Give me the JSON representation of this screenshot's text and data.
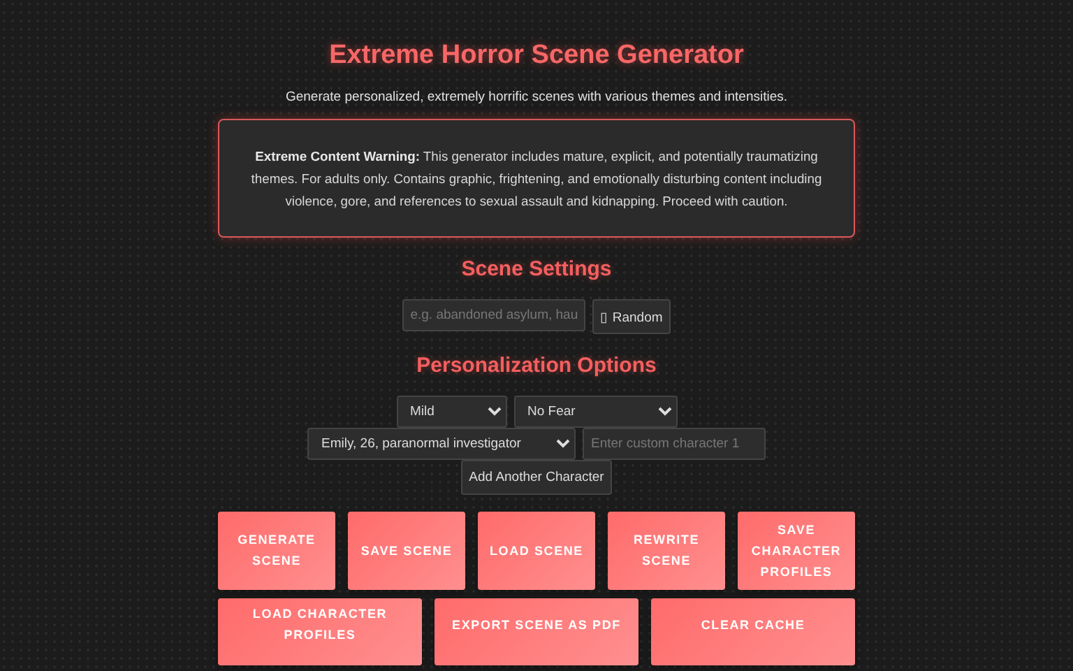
{
  "page": {
    "title": "Extreme Horror Scene Generator",
    "subtitle": "Generate personalized, extremely horrific scenes with various themes and intensities."
  },
  "warning": {
    "text": "**Extreme Content Warning:** This generator includes mature, explicit, and potentially traumatizing themes. For adults only. Contains graphic, frightening, and emotionally disturbing content including violence, gore, and references to sexual assault and kidnapping. Proceed with caution."
  },
  "scene_settings": {
    "heading": "Scene Settings",
    "location_field": {
      "placeholder": "e.g. abandoned asylum, hau"
    },
    "random_button": "▯ Random"
  },
  "personalization": {
    "heading": "Personalization Options",
    "rows": [
      [
        {
          "kind": "select",
          "value": "Mild"
        },
        {
          "kind": "select",
          "value": "No Fear"
        }
      ],
      [
        {
          "kind": "select",
          "value": "Emily, 26, paranormal investigator"
        },
        {
          "kind": "input",
          "placeholder": "Enter custom character 1"
        }
      ],
      [
        {
          "kind": "button",
          "label": "Add Another Character"
        }
      ]
    ]
  },
  "actions": [
    [
      "GENERATE SCENE",
      "SAVE SCENE",
      "LOAD SCENE",
      "REWRITE SCENE",
      "SAVE CHARACTER PROFILES"
    ],
    [
      "LOAD CHARACTER PROFILES",
      "EXPORT SCENE AS PDF",
      "CLEAR CACHE"
    ]
  ]
}
